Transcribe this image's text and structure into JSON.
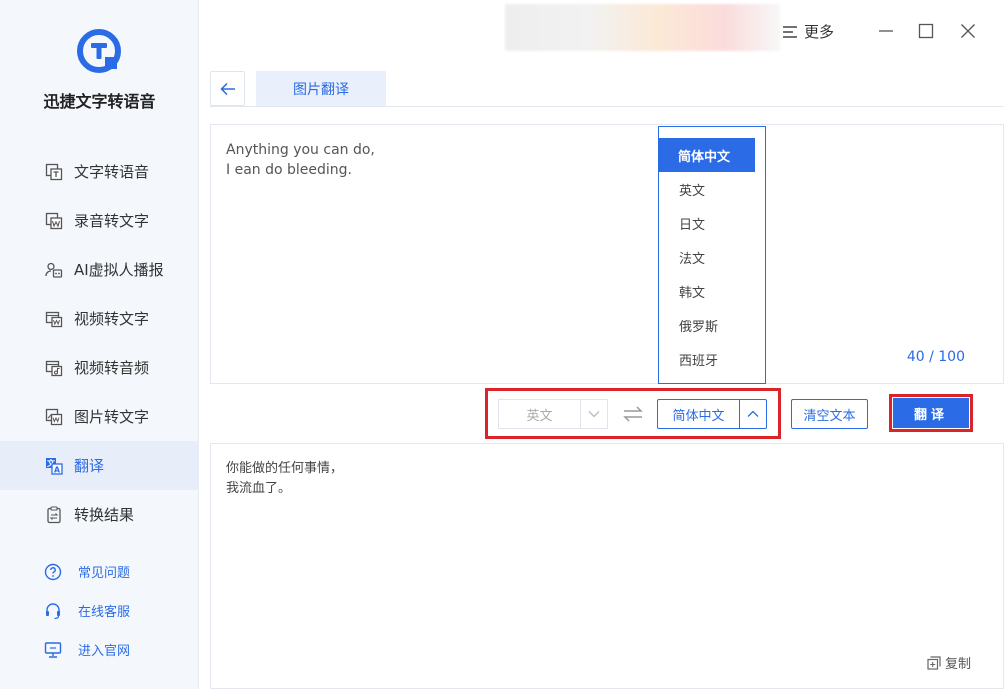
{
  "app": {
    "name": "迅捷文字转语音"
  },
  "sidebar": {
    "items": [
      {
        "label": "文字转语音",
        "icon": "text-to-speech-icon"
      },
      {
        "label": "录音转文字",
        "icon": "recording-to-text-icon"
      },
      {
        "label": "AI虚拟人播报",
        "icon": "ai-avatar-icon"
      },
      {
        "label": "视频转文字",
        "icon": "video-to-text-icon"
      },
      {
        "label": "视频转音频",
        "icon": "video-to-audio-icon"
      },
      {
        "label": "图片转文字",
        "icon": "image-to-text-icon"
      },
      {
        "label": "翻译",
        "icon": "translate-icon",
        "active": true
      },
      {
        "label": "转换结果",
        "icon": "results-icon"
      }
    ],
    "links": [
      {
        "label": "常见问题",
        "icon": "faq-icon"
      },
      {
        "label": "在线客服",
        "icon": "headset-icon"
      },
      {
        "label": "进入官网",
        "icon": "website-icon"
      }
    ]
  },
  "titlebar": {
    "more_label": "更多"
  },
  "tab": {
    "label": "图片翻译"
  },
  "source": {
    "line1": "Anything you can do,",
    "line2": "I ean do bleeding.",
    "char_count": "40 / 100"
  },
  "dropdown": {
    "options": [
      "简体中文",
      "英文",
      "日文",
      "法文",
      "韩文",
      "俄罗斯",
      "西班牙"
    ],
    "selected": "简体中文"
  },
  "controls": {
    "from_lang": "英文",
    "to_lang": "简体中文",
    "clear_label": "清空文本",
    "translate_label": "翻译"
  },
  "result": {
    "line1": "你能做的任何事情，",
    "line2": "我流血了。",
    "copy_label": "复制"
  },
  "colors": {
    "accent": "#2b6be6",
    "highlight": "#d9252a",
    "sidebar_bg": "#f4f8fd"
  }
}
